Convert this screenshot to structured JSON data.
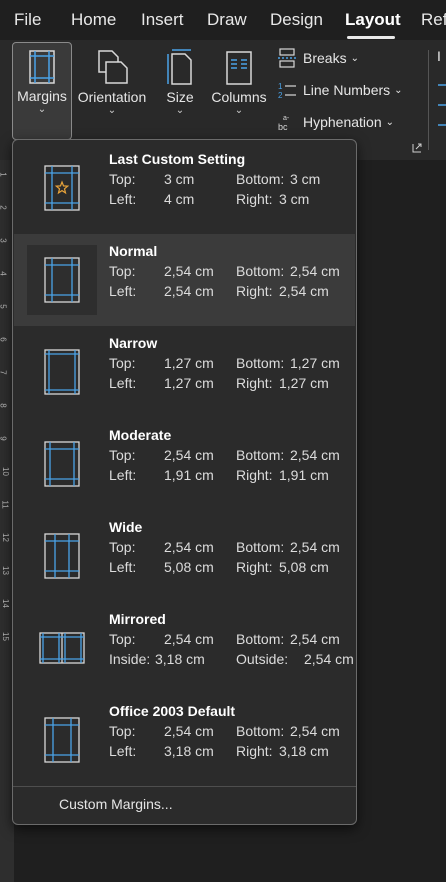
{
  "tabs": [
    "File",
    "Home",
    "Insert",
    "Draw",
    "Design",
    "Layout",
    "Refe"
  ],
  "ribbon": {
    "margins": "Margins",
    "orientation": "Orientation",
    "size": "Size",
    "columns": "Columns",
    "breaks": "Breaks",
    "line_numbers": "Line Numbers",
    "hyphenation": "Hyphenation",
    "partial": "I"
  },
  "ruler_numbers": [
    "1",
    "2",
    "3",
    "4",
    "5",
    "6",
    "7",
    "8",
    "9",
    "10",
    "11",
    "12",
    "13",
    "14",
    "15"
  ],
  "margin_options": [
    {
      "name": "Last Custom Setting",
      "row1_label": "Top:",
      "row1_value": "3 cm",
      "row1b_label": "Bottom:",
      "row1b_value": "3 cm",
      "row2_label": "Left:",
      "row2_value": "4 cm",
      "row2b_label": "Right:",
      "row2b_value": "3 cm"
    },
    {
      "name": "Normal",
      "row1_label": "Top:",
      "row1_value": "2,54 cm",
      "row1b_label": "Bottom:",
      "row1b_value": "2,54 cm",
      "row2_label": "Left:",
      "row2_value": "2,54 cm",
      "row2b_label": "Right:",
      "row2b_value": "2,54 cm"
    },
    {
      "name": "Narrow",
      "row1_label": "Top:",
      "row1_value": "1,27 cm",
      "row1b_label": "Bottom:",
      "row1b_value": "1,27 cm",
      "row2_label": "Left:",
      "row2_value": "1,27 cm",
      "row2b_label": "Right:",
      "row2b_value": "1,27 cm"
    },
    {
      "name": "Moderate",
      "row1_label": "Top:",
      "row1_value": "2,54 cm",
      "row1b_label": "Bottom:",
      "row1b_value": "2,54 cm",
      "row2_label": "Left:",
      "row2_value": "1,91 cm",
      "row2b_label": "Right:",
      "row2b_value": "1,91 cm"
    },
    {
      "name": "Wide",
      "row1_label": "Top:",
      "row1_value": "2,54 cm",
      "row1b_label": "Bottom:",
      "row1b_value": "2,54 cm",
      "row2_label": "Left:",
      "row2_value": "5,08 cm",
      "row2b_label": "Right:",
      "row2b_value": "5,08 cm"
    },
    {
      "name": "Mirrored",
      "row1_label": "Top:",
      "row1_value": "2,54 cm",
      "row1b_label": "Bottom:",
      "row1b_value": "2,54 cm",
      "row2_label": "Inside:",
      "row2_value": "3,18 cm",
      "row2b_label": "Outside:",
      "row2b_value": "2,54 cm"
    },
    {
      "name": "Office 2003 Default",
      "row1_label": "Top:",
      "row1_value": "2,54 cm",
      "row1b_label": "Bottom:",
      "row1b_value": "2,54 cm",
      "row2_label": "Left:",
      "row2_value": "3,18 cm",
      "row2b_label": "Right:",
      "row2b_value": "3,18 cm"
    }
  ],
  "custom_margins": "Custom Margins...",
  "colors": {
    "accent": "#4aa3e8",
    "star": "#e8a33a"
  }
}
